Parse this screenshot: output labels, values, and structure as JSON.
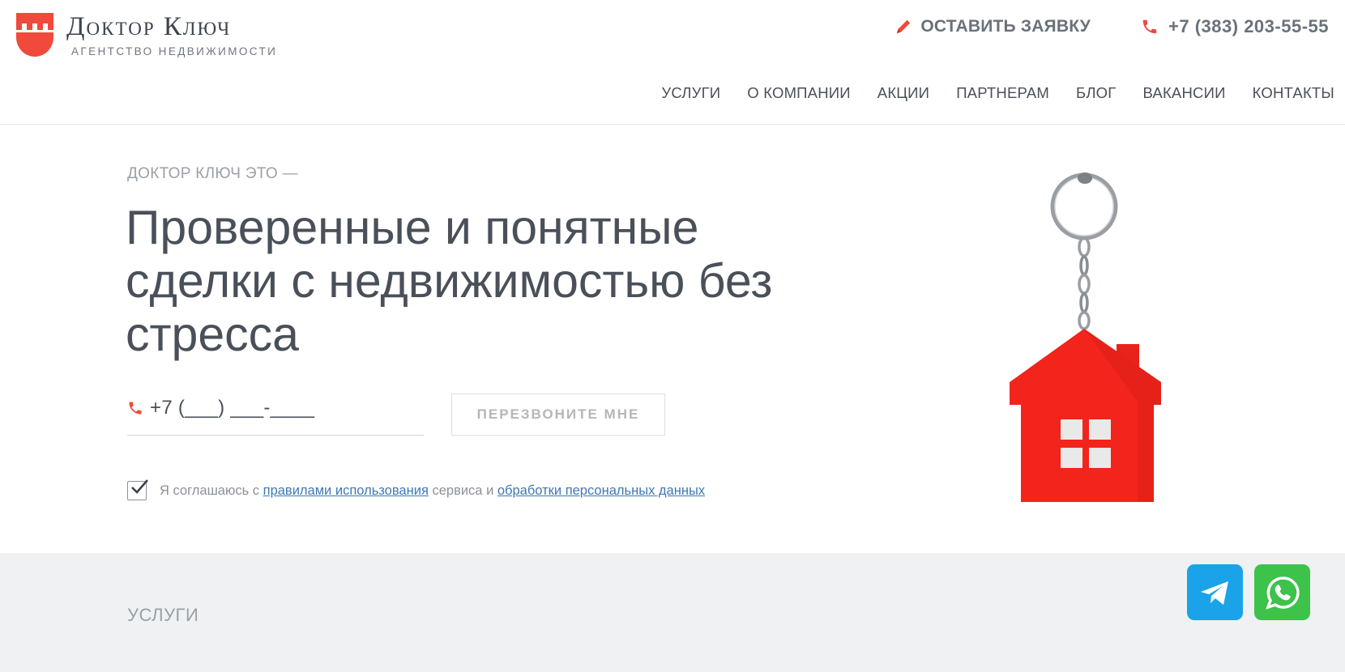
{
  "brand": {
    "name": "Доктор Ключ",
    "tagline": "АГЕНТСТВО НЕДВИЖИМОСТИ",
    "accent_color": "#ef4a3c"
  },
  "header": {
    "request_label": "ОСТАВИТЬ ЗАЯВКУ",
    "request_icon": "pencil-icon",
    "phone": "+7 (383) 203-55-55",
    "phone_icon": "phone-icon"
  },
  "nav": {
    "items": [
      {
        "label": "УСЛУГИ"
      },
      {
        "label": "О КОМПАНИИ"
      },
      {
        "label": "АКЦИИ"
      },
      {
        "label": "ПАРТНЕРАМ"
      },
      {
        "label": "БЛОГ"
      },
      {
        "label": "ВАКАНСИИ"
      },
      {
        "label": "КОНТАКТЫ"
      }
    ]
  },
  "hero": {
    "kicker": "ДОКТОР КЛЮЧ ЭТО —",
    "title": "Проверенные и понятные сделки с недвижимостью без стресса",
    "phone_input_value": "+7 (___) ___-____",
    "callback_button": "ПЕРЕЗВОНИТЕ МНЕ",
    "consent": {
      "checked": true,
      "prefix": "Я соглашаюсь с ",
      "link1": "правилами использования",
      "middle": " сервиса и ",
      "link2": "обработки персональных данных"
    }
  },
  "services": {
    "label": "УСЛУГИ"
  },
  "messengers": {
    "telegram_icon": "telegram-icon",
    "whatsapp_icon": "whatsapp-icon",
    "telegram_color": "#1aa3e8",
    "whatsapp_color": "#3dc24a"
  }
}
